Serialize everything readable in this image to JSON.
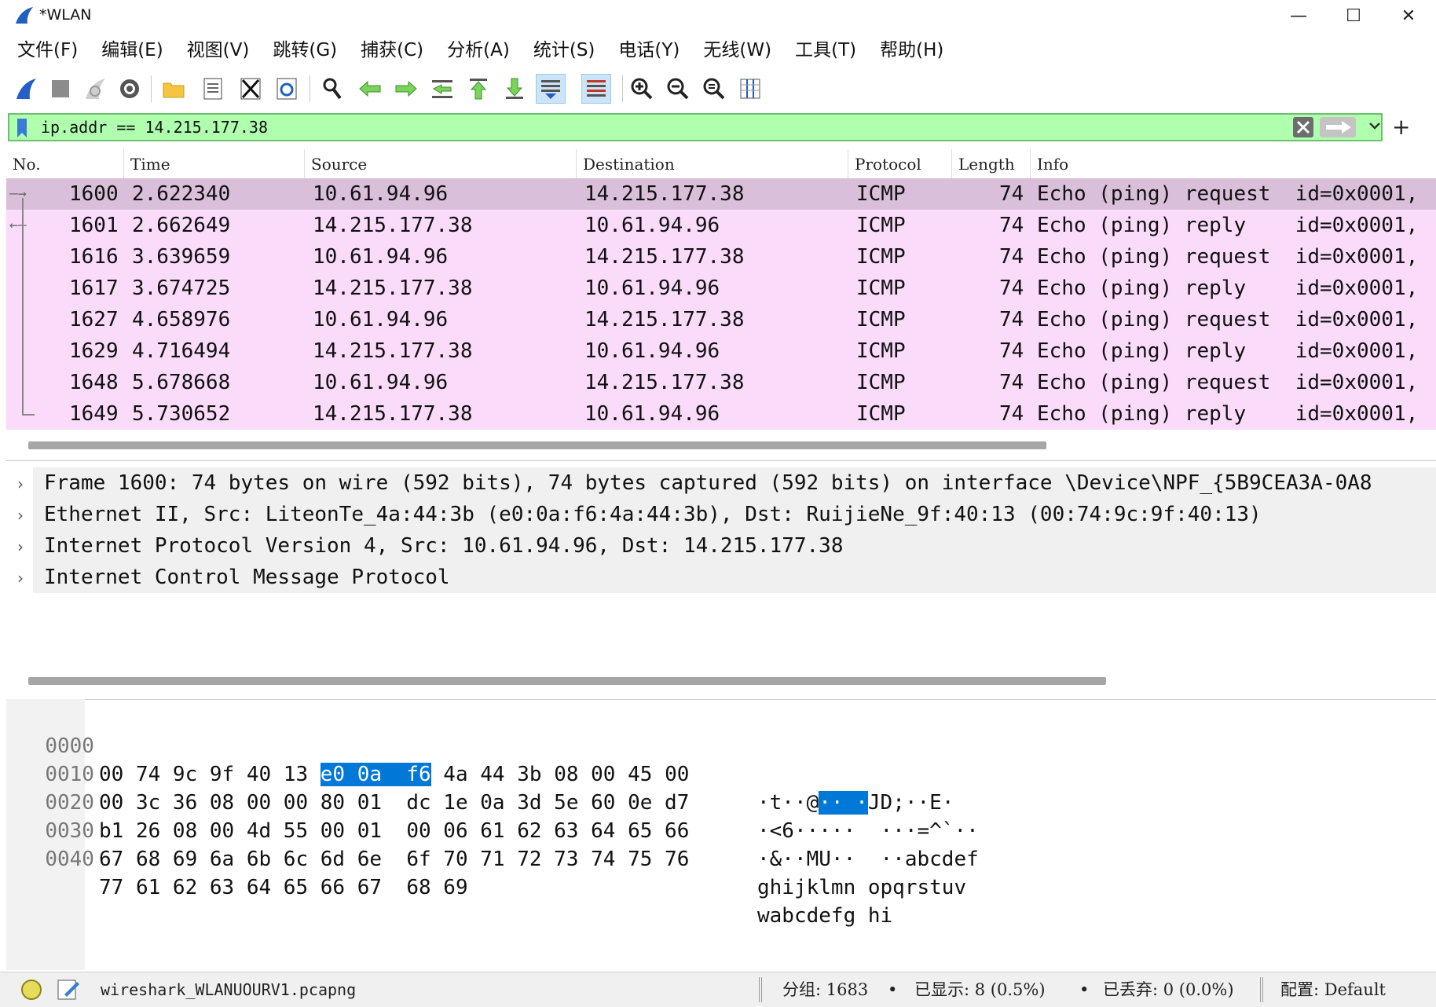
{
  "window": {
    "title": "*WLAN",
    "minimize": "—",
    "maximize": "☐",
    "close": "✕"
  },
  "menu": [
    "文件(F)",
    "编辑(E)",
    "视图(V)",
    "跳转(G)",
    "捕获(C)",
    "分析(A)",
    "统计(S)",
    "电话(Y)",
    "无线(W)",
    "工具(T)",
    "帮助(H)"
  ],
  "filter": {
    "value": "ip.addr == 14.215.177.38",
    "plus": "+"
  },
  "columns": [
    "No.",
    "Time",
    "Source",
    "Destination",
    "Protocol",
    "Length",
    "Info"
  ],
  "packets": [
    {
      "no": "1600",
      "time": "2.622340",
      "src": "10.61.94.96",
      "dst": "14.215.177.38",
      "proto": "ICMP",
      "len": "74",
      "info": "Echo (ping) request  id=0x0001,"
    },
    {
      "no": "1601",
      "time": "2.662649",
      "src": "14.215.177.38",
      "dst": "10.61.94.96",
      "proto": "ICMP",
      "len": "74",
      "info": "Echo (ping) reply    id=0x0001,"
    },
    {
      "no": "1616",
      "time": "3.639659",
      "src": "10.61.94.96",
      "dst": "14.215.177.38",
      "proto": "ICMP",
      "len": "74",
      "info": "Echo (ping) request  id=0x0001,"
    },
    {
      "no": "1617",
      "time": "3.674725",
      "src": "14.215.177.38",
      "dst": "10.61.94.96",
      "proto": "ICMP",
      "len": "74",
      "info": "Echo (ping) reply    id=0x0001,"
    },
    {
      "no": "1627",
      "time": "4.658976",
      "src": "10.61.94.96",
      "dst": "14.215.177.38",
      "proto": "ICMP",
      "len": "74",
      "info": "Echo (ping) request  id=0x0001,"
    },
    {
      "no": "1629",
      "time": "4.716494",
      "src": "14.215.177.38",
      "dst": "10.61.94.96",
      "proto": "ICMP",
      "len": "74",
      "info": "Echo (ping) reply    id=0x0001,"
    },
    {
      "no": "1648",
      "time": "5.678668",
      "src": "10.61.94.96",
      "dst": "14.215.177.38",
      "proto": "ICMP",
      "len": "74",
      "info": "Echo (ping) request  id=0x0001,"
    },
    {
      "no": "1649",
      "time": "5.730652",
      "src": "14.215.177.38",
      "dst": "10.61.94.96",
      "proto": "ICMP",
      "len": "74",
      "info": "Echo (ping) reply    id=0x0001,"
    }
  ],
  "details": [
    "Frame 1600: 74 bytes on wire (592 bits), 74 bytes captured (592 bits) on interface \\Device\\NPF_{5B9CEA3A-0A8",
    "Ethernet II, Src: LiteonTe_4a:44:3b (e0:0a:f6:4a:44:3b), Dst: RuijieNe_9f:40:13 (00:74:9c:9f:40:13)",
    "Internet Protocol Version 4, Src: 10.61.94.96, Dst: 14.215.177.38",
    "Internet Control Message Protocol"
  ],
  "bytes": [
    {
      "off": "0000",
      "hexA": "00 74 9c 9f 40 13 ",
      "hexHl": "e0 0a  f6",
      "hexB": " 4a 44 3b 08 00 45 00",
      "ascA": "·t··@",
      "ascHl": "·· ·",
      "ascB": "JD;··E·"
    },
    {
      "off": "0010",
      "hexA": "00 3c 36 08 00 00 80 01  dc 1e 0a 3d 5e 60 0e d7",
      "hexHl": "",
      "hexB": "",
      "ascA": "·<6·····  ···=^`··",
      "ascHl": "",
      "ascB": ""
    },
    {
      "off": "0020",
      "hexA": "b1 26 08 00 4d 55 00 01  00 06 61 62 63 64 65 66",
      "hexHl": "",
      "hexB": "",
      "ascA": "·&··MU··  ··abcdef",
      "ascHl": "",
      "ascB": ""
    },
    {
      "off": "0030",
      "hexA": "67 68 69 6a 6b 6c 6d 6e  6f 70 71 72 73 74 75 76",
      "hexHl": "",
      "hexB": "",
      "ascA": "ghijklmn opqrstuv",
      "ascHl": "",
      "ascB": ""
    },
    {
      "off": "0040",
      "hexA": "77 61 62 63 64 65 66 67  68 69",
      "hexHl": "",
      "hexB": "",
      "ascA": "wabcdefg hi",
      "ascHl": "",
      "ascB": ""
    }
  ],
  "status": {
    "file": "wireshark_WLANUOURV1.pcapng",
    "packets": "分组: 1683",
    "displayed": "已显示: 8 (0.5%)",
    "dropped": "已丢弃: 0 (0.0%)",
    "profile": "配置: Default"
  },
  "colors": {
    "filter_valid": "#afffaf",
    "icmp_row": "#fadcfa",
    "selected_row": "#d9bfd9",
    "byte_highlight": "#0078d7"
  }
}
